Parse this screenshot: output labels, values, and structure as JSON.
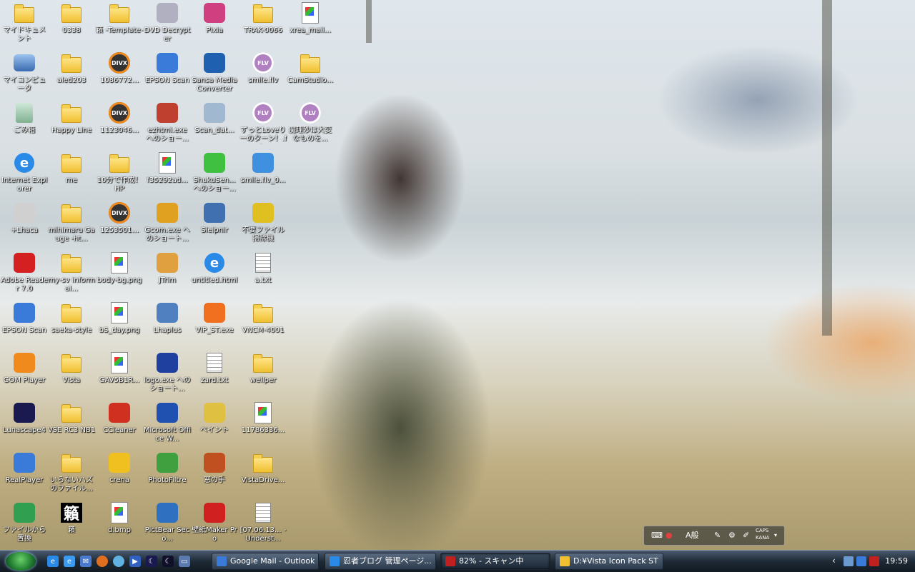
{
  "desktop": {
    "icons": [
      {
        "label": "マイドキュメント",
        "icon": "my-documents-icon",
        "kind": "folder"
      },
      {
        "label": "マイコンピュータ",
        "icon": "my-computer-icon",
        "kind": "pc"
      },
      {
        "label": "ごみ箱",
        "icon": "recycle-bin-icon",
        "kind": "bin"
      },
      {
        "label": "Internet Explorer",
        "icon": "internet-explorer-icon",
        "kind": "ie"
      },
      {
        "label": "+Lhaca",
        "icon": "lhaca-icon",
        "kind": "app",
        "color": "#d0d0d0"
      },
      {
        "label": "Adobe Reader 7.0",
        "icon": "adobe-reader-icon",
        "kind": "app",
        "color": "#d42020"
      },
      {
        "label": "EPSON Scan",
        "icon": "epson-scan-icon",
        "kind": "app",
        "color": "#3a7ad8"
      },
      {
        "label": "GOM Player",
        "icon": "gom-player-icon",
        "kind": "app",
        "color": "#f08a1c"
      },
      {
        "label": "Lunascape4",
        "icon": "lunascape-icon",
        "kind": "app",
        "color": "#1a1a50"
      },
      {
        "label": "RealPlayer",
        "icon": "realplayer-icon",
        "kind": "app",
        "color": "#3a7ad8"
      },
      {
        "label": "ファイルから置換",
        "icon": "file-replace-icon",
        "kind": "app",
        "color": "#30a050"
      },
      {
        "label": "0338",
        "icon": "folder-icon",
        "kind": "folder"
      },
      {
        "label": "aled203",
        "icon": "folder-icon",
        "kind": "folder"
      },
      {
        "label": "Happy Line",
        "icon": "folder-icon",
        "kind": "folder"
      },
      {
        "label": "me",
        "icon": "folder-icon",
        "kind": "folder"
      },
      {
        "label": "mihimaru Gauge -ht...",
        "icon": "folder-icon",
        "kind": "folder"
      },
      {
        "label": "my-sv informal...",
        "icon": "folder-icon",
        "kind": "folder"
      },
      {
        "label": "saeka-style",
        "icon": "folder-icon",
        "kind": "folder"
      },
      {
        "label": "Vista",
        "icon": "folder-icon",
        "kind": "folder"
      },
      {
        "label": "VSE RC3 NB1",
        "icon": "folder-icon",
        "kind": "folder"
      },
      {
        "label": "いらないハズのファイル...",
        "icon": "folder-icon",
        "kind": "folder"
      },
      {
        "label": "籟",
        "icon": "kanji-file-icon",
        "kind": "kanji"
      },
      {
        "label": "籟 -Template-",
        "icon": "folder-icon",
        "kind": "folder"
      },
      {
        "label": "1086772...",
        "icon": "divx-file-icon",
        "kind": "divx"
      },
      {
        "label": "1123046...",
        "icon": "divx-file-icon",
        "kind": "divx"
      },
      {
        "label": "10分で作成！HP",
        "icon": "folder-icon",
        "kind": "folder"
      },
      {
        "label": "1253501...",
        "icon": "divx-file-icon",
        "kind": "divx"
      },
      {
        "label": "body-bg.png",
        "icon": "image-file-icon",
        "kind": "doc"
      },
      {
        "label": "bS_day.png",
        "icon": "image-file-icon",
        "kind": "doc"
      },
      {
        "label": "GAV5B1R...",
        "icon": "image-file-icon",
        "kind": "doc"
      },
      {
        "label": "CCleaner",
        "icon": "ccleaner-icon",
        "kind": "app",
        "color": "#d03020"
      },
      {
        "label": "crena",
        "icon": "crena-icon",
        "kind": "app",
        "color": "#f0c020"
      },
      {
        "label": "d.bmp",
        "icon": "bitmap-file-icon",
        "kind": "doc"
      },
      {
        "label": "DVD Decrypter",
        "icon": "dvd-decrypter-icon",
        "kind": "app",
        "color": "#b0b0c0"
      },
      {
        "label": "EPSON Scan",
        "icon": "epson-scan-icon",
        "kind": "app",
        "color": "#3a7ad8"
      },
      {
        "label": "ezhtml.exe へのショー...",
        "icon": "ezhtml-icon",
        "kind": "app",
        "color": "#c04030"
      },
      {
        "label": "f35292ad...",
        "icon": "image-file-icon",
        "kind": "doc"
      },
      {
        "label": "Gcom.exe へのショート...",
        "icon": "gcom-icon",
        "kind": "app",
        "color": "#e0a020"
      },
      {
        "label": "JTrim",
        "icon": "jtrim-icon",
        "kind": "app",
        "color": "#e0a040"
      },
      {
        "label": "Lhaplus",
        "icon": "lhaplus-icon",
        "kind": "app",
        "color": "#5080c0"
      },
      {
        "label": "logo.exe へのショート...",
        "icon": "logo-exe-icon",
        "kind": "app",
        "color": "#2040a0"
      },
      {
        "label": "Microsoft Office W...",
        "icon": "word-icon",
        "kind": "app",
        "color": "#2050b0"
      },
      {
        "label": "PhotoFiltre",
        "icon": "photofiltre-icon",
        "kind": "app",
        "color": "#40a040"
      },
      {
        "label": "PictBear Seco...",
        "icon": "pictbear-icon",
        "kind": "app",
        "color": "#3070c0"
      },
      {
        "label": "Pixia",
        "icon": "pixia-icon",
        "kind": "app",
        "color": "#d04080"
      },
      {
        "label": "Sansa Media Converter",
        "icon": "sansa-icon",
        "kind": "app",
        "color": "#2060b0"
      },
      {
        "label": "Scan_dat...",
        "icon": "scan-data-icon",
        "kind": "app",
        "color": "#a0b8d0"
      },
      {
        "label": "ShukuSen... へのショー...",
        "icon": "shukusen-icon",
        "kind": "app",
        "color": "#40c040"
      },
      {
        "label": "Sleipnir",
        "icon": "sleipnir-icon",
        "kind": "app",
        "color": "#4070b0"
      },
      {
        "label": "untitled.html",
        "icon": "ie-document-icon",
        "kind": "ie"
      },
      {
        "label": "VIP_ST.exe",
        "icon": "vip-st-icon",
        "kind": "app",
        "color": "#f07020"
      },
      {
        "label": "zard.txt",
        "icon": "text-file-icon",
        "kind": "txt"
      },
      {
        "label": "ペイント",
        "icon": "paint-icon",
        "kind": "app",
        "color": "#e0c040"
      },
      {
        "label": "窓の手",
        "icon": "madonote-icon",
        "kind": "app",
        "color": "#c05020"
      },
      {
        "label": "壁紙Maker Pro",
        "icon": "wallpaper-maker-icon",
        "kind": "app",
        "color": "#d02020"
      },
      {
        "label": "TRAK-0066",
        "icon": "folder-icon",
        "kind": "folder"
      },
      {
        "label": "smile.flv",
        "icon": "flv-file-icon",
        "kind": "flv"
      },
      {
        "label": "ずっとLoveりーのターン！.flv",
        "icon": "flv-file-icon",
        "kind": "flv"
      },
      {
        "label": "smile.flv_0...",
        "icon": "itunes-file-icon",
        "kind": "app",
        "color": "#4090e0"
      },
      {
        "label": "不要ファイル掃除機",
        "icon": "cleaner-icon",
        "kind": "app",
        "color": "#e0c020"
      },
      {
        "label": "a.txt",
        "icon": "text-file-icon",
        "kind": "txt"
      },
      {
        "label": "VNCM-4001",
        "icon": "folder-icon",
        "kind": "folder"
      },
      {
        "label": "wellper",
        "icon": "folder-icon",
        "kind": "folder"
      },
      {
        "label": "11786336...",
        "icon": "image-file-icon",
        "kind": "doc"
      },
      {
        "label": "VistaDrive...",
        "icon": "folder-icon",
        "kind": "folder"
      },
      {
        "label": "[07.06.13... - Underst...",
        "icon": "avi-file-icon",
        "kind": "txt"
      },
      {
        "label": "xrea_mail...",
        "icon": "image-file-icon",
        "kind": "doc"
      },
      {
        "label": "CamStudio...",
        "icon": "folder-icon",
        "kind": "folder"
      },
      {
        "label": "魔理沙は大変なものを...",
        "icon": "flv-file-icon",
        "kind": "flv"
      }
    ]
  },
  "langbar": {
    "mode_label": "A般",
    "caps": "CAPS",
    "kana": "KANA"
  },
  "taskbar": {
    "quicklaunch": [
      "internet-explorer-icon",
      "ie-alt-icon",
      "outlook-icon",
      "firefox-icon",
      "messenger-icon",
      "media-player-icon",
      "lunascape-icon",
      "show-desktop-icon"
    ],
    "tasks": [
      {
        "label": "Google Mail - Outlook ...",
        "icon": "outlook-icon",
        "color": "#3a7ad8"
      },
      {
        "label": "忍者ブログ 管理ページ...",
        "icon": "ie-icon",
        "color": "#2a8ae8"
      },
      {
        "label": "82% - スキャン中",
        "icon": "kaspersky-icon",
        "color": "#c02020"
      },
      {
        "label": "D:¥Vista Icon Pack ST",
        "icon": "folder-icon",
        "color": "#f0c030"
      }
    ],
    "clock": "19:59"
  },
  "colors": {
    "taskbar_dark": "#1e2a36",
    "folder_yellow": "#f0c030"
  }
}
